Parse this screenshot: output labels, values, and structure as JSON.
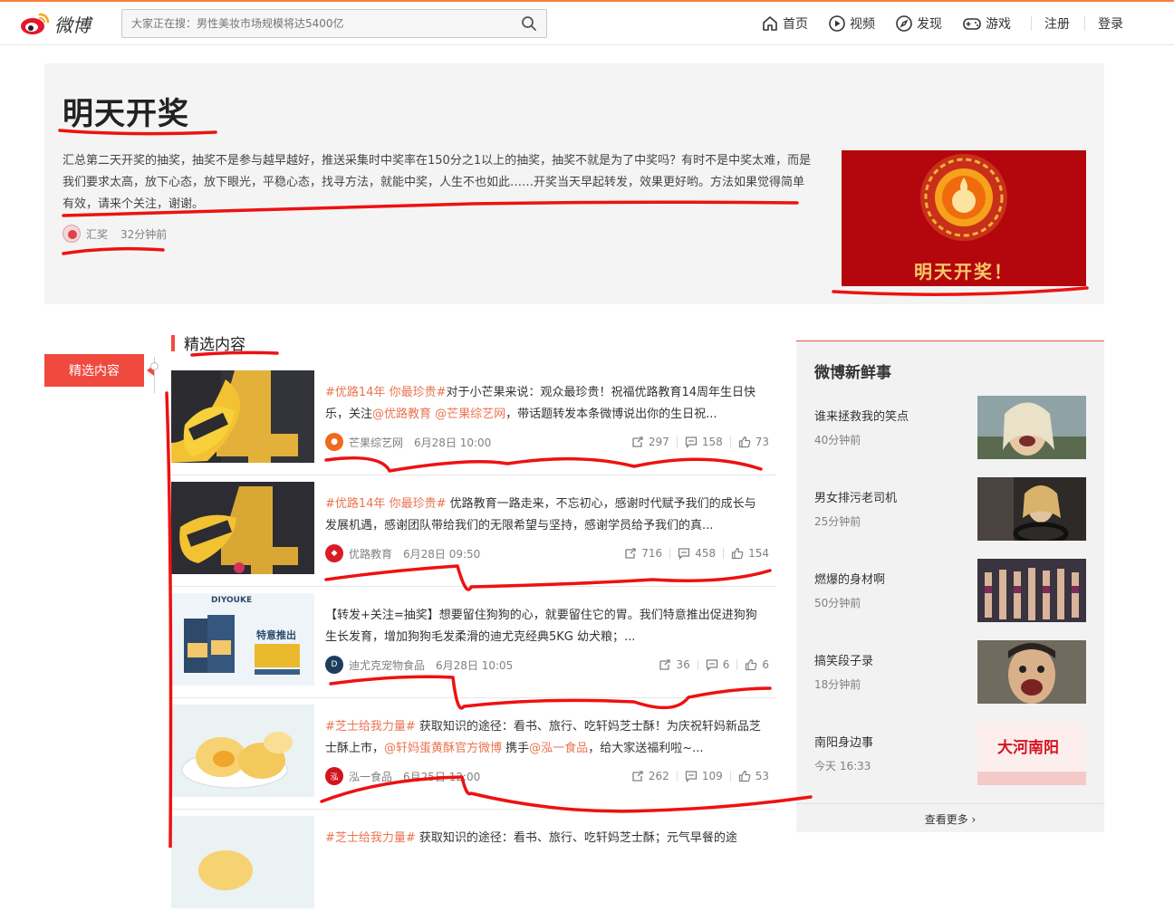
{
  "header": {
    "logo_text": "微博",
    "search_placeholder": "大家正在搜：男性美妆市场规模将达5400亿",
    "nav": [
      {
        "label": "首页",
        "icon": "home-icon"
      },
      {
        "label": "视频",
        "icon": "video-icon"
      },
      {
        "label": "发现",
        "icon": "compass-icon"
      },
      {
        "label": "游戏",
        "icon": "gamepad-icon"
      }
    ],
    "register": "注册",
    "login": "登录"
  },
  "hero": {
    "title": "明天开奖",
    "description": "汇总第二天开奖的抽奖，抽奖不是参与越早越好，推送采集时中奖率在150分之1以上的抽奖，抽奖不就是为了中奖吗？有时不是中奖太难，而是我们要求太高，放下心态，放下眼光，平稳心态，找寻方法，就能中奖，人生不也如此……开奖当天早起转发，效果更好哟。方法如果觉得简单有效，请来个关注，谢谢。",
    "author": "汇奖",
    "time": "32分钟前",
    "image_caption": "明天开奖！"
  },
  "side_tab": "精选内容",
  "section_title": "精选内容",
  "feed": [
    {
      "tag": "#优路14年 你最珍贵#",
      "text": "对于小芒果来说：观众最珍贵！祝福优路教育14周年生日快乐，关注",
      "mention1": "@优路教育",
      "mention2": " @芒果综艺网",
      "text2": "，带话题转发本条微博说出你的生日祝...",
      "source": "芒果综艺网",
      "date": "6月28日 10:00",
      "reposts": "297",
      "comments": "158",
      "likes": "73"
    },
    {
      "tag": "#优路14年 你最珍贵#",
      "text": " 优路教育一路走来，不忘初心，感谢时代赋予我们的成长与发展机遇，感谢团队带给我们的无限希望与坚持，感谢学员给予我们的真...",
      "source": "优路教育",
      "date": "6月28日 09:50",
      "reposts": "716",
      "comments": "458",
      "likes": "154"
    },
    {
      "text": "【转发+关注=抽奖】想要留住狗狗的心，就要留住它的胃。我们特意推出促进狗狗生长发育，增加狗狗毛发柔滑的迪尤克经典5KG 幼犬粮；...",
      "source": "迪尤克宠物食品",
      "date": "6月28日 10:05",
      "reposts": "36",
      "comments": "6",
      "likes": "6",
      "thumb_brand": "DIYOUKE",
      "thumb_caption": "特意推出"
    },
    {
      "tag": "#芝士给我力量#",
      "text": " 获取知识的途径：看书、旅行、吃轩妈芝士酥！为庆祝轩妈新品芝士酥上市，",
      "mention1": "@轩妈蛋黄酥官方微博",
      "text_mid": " 携手",
      "mention2": "@泓一食品",
      "text2": "，给大家送福利啦~...",
      "source": "泓一食品",
      "date": "6月25日 12:00",
      "reposts": "262",
      "comments": "109",
      "likes": "53"
    },
    {
      "tag": "#芝士给我力量#",
      "text": " 获取知识的途径：看书、旅行、吃轩妈芝士酥；元气早餐的途"
    }
  ],
  "sidebar": {
    "title": "微博新鲜事",
    "items": [
      {
        "title": "谁来拯救我的笑点",
        "time": "40分钟前"
      },
      {
        "title": "男女排污老司机",
        "time": "25分钟前"
      },
      {
        "title": "燃爆的身材啊",
        "time": "50分钟前"
      },
      {
        "title": "搞笑段子录",
        "time": "18分钟前"
      },
      {
        "title": "南阳身边事",
        "time": "今天 16:33",
        "image_text": "大河南阳"
      }
    ],
    "more": "查看更多 ›"
  },
  "colors": {
    "accent": "#f04a3f",
    "topic_orange": "#eb7350",
    "header_line": "#fa7d3c",
    "annotation_red": "#ee1111"
  }
}
